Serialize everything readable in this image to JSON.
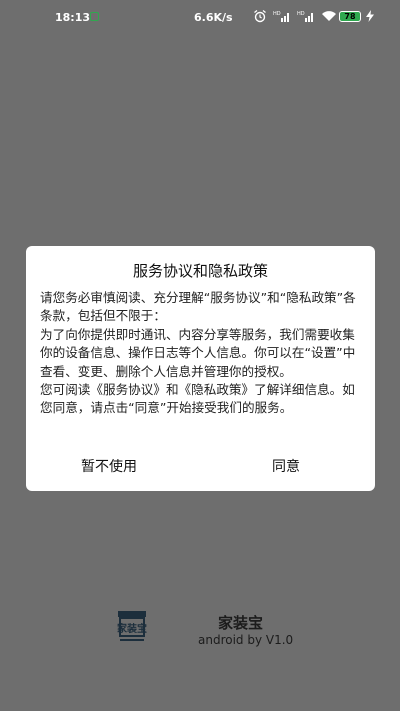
{
  "status_bar": {
    "time": "18:13",
    "network_speed": "6.6K/s",
    "battery_level": "78",
    "icons": [
      "notification-icon",
      "alarm-icon",
      "hd-signal-icon",
      "signal-icon",
      "hd-signal-icon",
      "signal-icon",
      "wifi-icon",
      "battery-icon",
      "charging-icon"
    ]
  },
  "dialog": {
    "title": "服务协议和隐私政策",
    "paragraphs": [
      "请您务必审慎阅读、充分理解“服务协议”和“隐私政策”各条款，包括但不限于：",
      "为了向你提供即时通讯、内容分享等服务，我们需要收集你的设备信息、操作日志等个人信息。你可以在“设置”中查看、变更、删除个人信息并管理你的授权。",
      "您可阅读《服务协议》和《隐私政策》了解详细信息。如您同意，请点击“同意”开始接受我们的服务。"
    ],
    "decline_label": "暂不使用",
    "agree_label": "同意"
  },
  "app": {
    "logo_text": "家装宝",
    "name": "家装宝",
    "version": "android by V1.0"
  }
}
